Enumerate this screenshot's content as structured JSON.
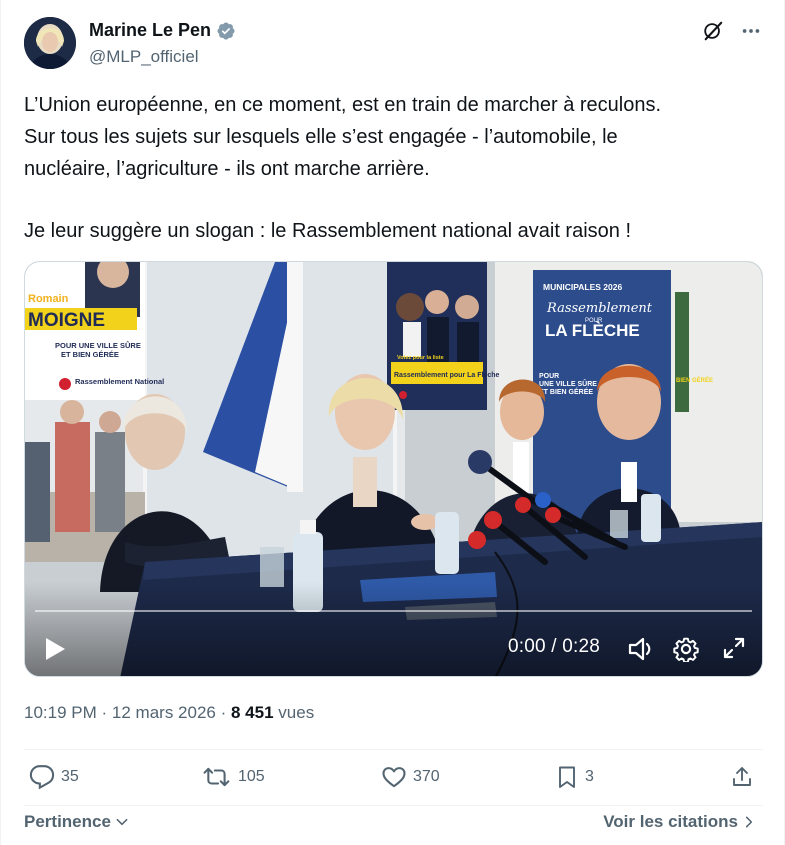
{
  "author": {
    "name": "Marine Le Pen",
    "handle": "@MLP_officiel",
    "verified": true,
    "avatar_icon": "profile-photo-icon"
  },
  "header_icons": [
    "grok-icon",
    "more-icon"
  ],
  "tweet": {
    "lines": [
      "L’Union européenne, en ce moment, est en train de marcher à reculons.",
      "Sur tous les sujets sur lesquels elle s’est engagée - l’automobile, le",
      "nucléaire, l’agriculture - ils ont marche arrière.",
      "Je leur suggère un slogan : le Rassemblement national avait raison !"
    ]
  },
  "video": {
    "time": "0:00 / 0:28",
    "progress": 0.0,
    "poster_texts": {
      "left_name_top": "Romain",
      "left_name": "MOIGNE",
      "left_sub1": "POUR UNE VILLE SÛRE",
      "left_sub2": "ET BIEN GÉRÉE",
      "left_brand": "Rassemblement National",
      "center_top": "Votez pour la liste",
      "center_main": "Rassemblement pour La Flèche",
      "right_top": "MUNICIPALES 2026",
      "right_script": "Rassemblement",
      "right_pour": "POUR",
      "right_main": "LA FLÈCHE",
      "right_sub1": "POUR",
      "right_sub2": "UNE VILLE SÛRE",
      "right_sub3": "ET BIEN GÉRÉE",
      "edge_text": "BIEN GÉRÉE"
    }
  },
  "meta": {
    "time": "10:19 PM",
    "dot": "·",
    "date": "12 mars 2026",
    "dot2": "·",
    "views_count": "8 451",
    "views_label": "vues"
  },
  "actions": {
    "replies": "35",
    "reposts": "105",
    "likes": "370",
    "bookmarks": "3"
  },
  "footer": {
    "sort_label": "Pertinence",
    "quotes_link": "Voir les citations"
  },
  "colors": {
    "text": "#0f1419",
    "secondary": "#536471",
    "verified": "#829aab",
    "border": "#eff3f4"
  }
}
